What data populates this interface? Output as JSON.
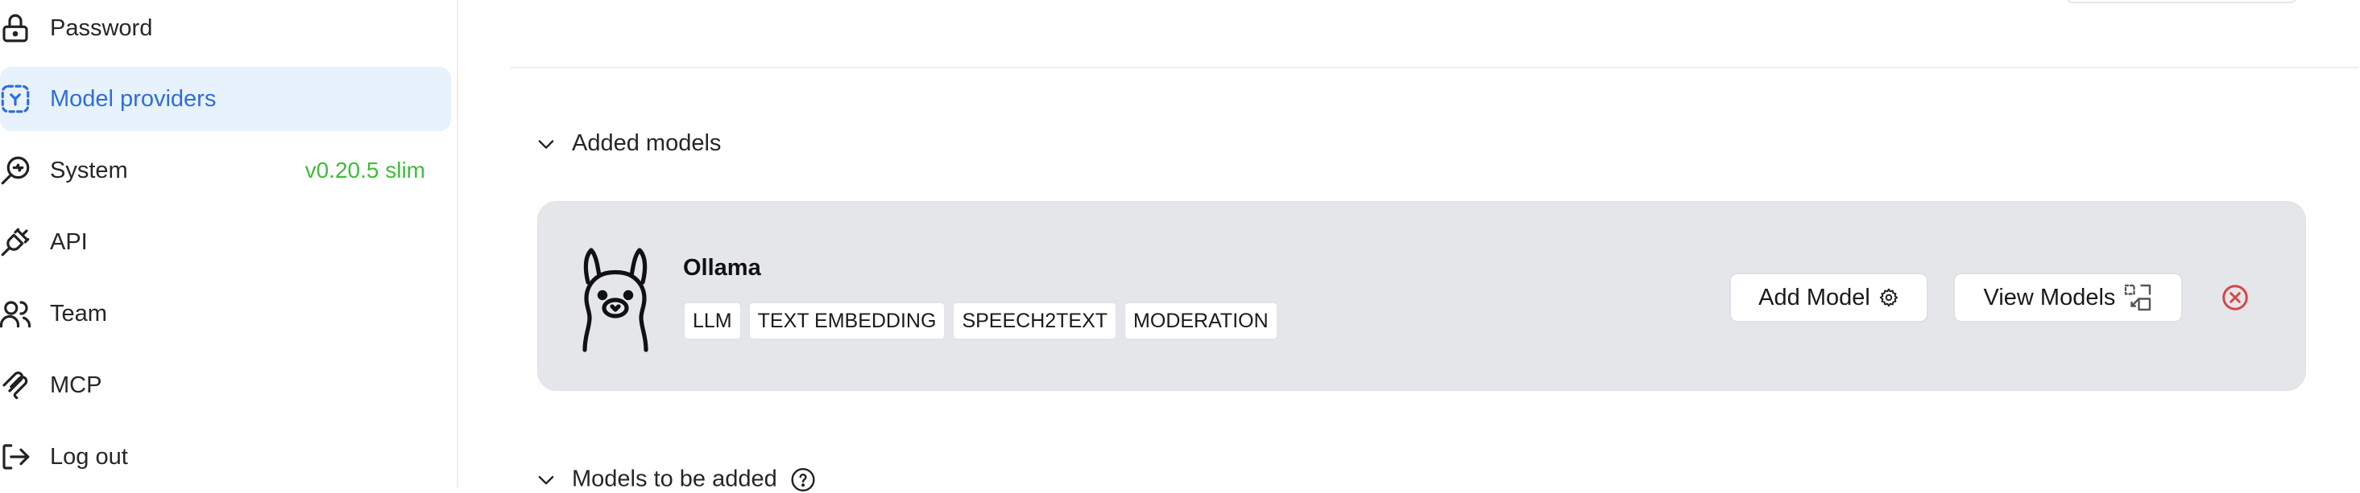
{
  "sidebar": {
    "items": [
      {
        "label": "Password",
        "icon": "lock-icon"
      },
      {
        "label": "Model providers",
        "icon": "model-providers-icon",
        "active": true
      },
      {
        "label": "System",
        "icon": "system-icon",
        "badge": "v0.20.5 slim"
      },
      {
        "label": "API",
        "icon": "plug-icon"
      },
      {
        "label": "Team",
        "icon": "users-icon"
      },
      {
        "label": "MCP",
        "icon": "mcp-icon"
      },
      {
        "label": "Log out",
        "icon": "logout-icon"
      }
    ]
  },
  "main": {
    "added_models_title": "Added models",
    "to_be_added_title": "Models to be added",
    "provider": {
      "name": "Ollama",
      "icon": "llama-icon",
      "tags": [
        "LLM",
        "TEXT EMBEDDING",
        "SPEECH2TEXT",
        "MODERATION"
      ],
      "add_model_label": "Add Model",
      "view_models_label": "View Models"
    }
  },
  "colors": {
    "accent": "#2d6fdc",
    "active_bg": "#e8f2fc",
    "badge": "#3ebd3a",
    "card_bg": "#e4e6ea",
    "remove": "#d64545"
  }
}
